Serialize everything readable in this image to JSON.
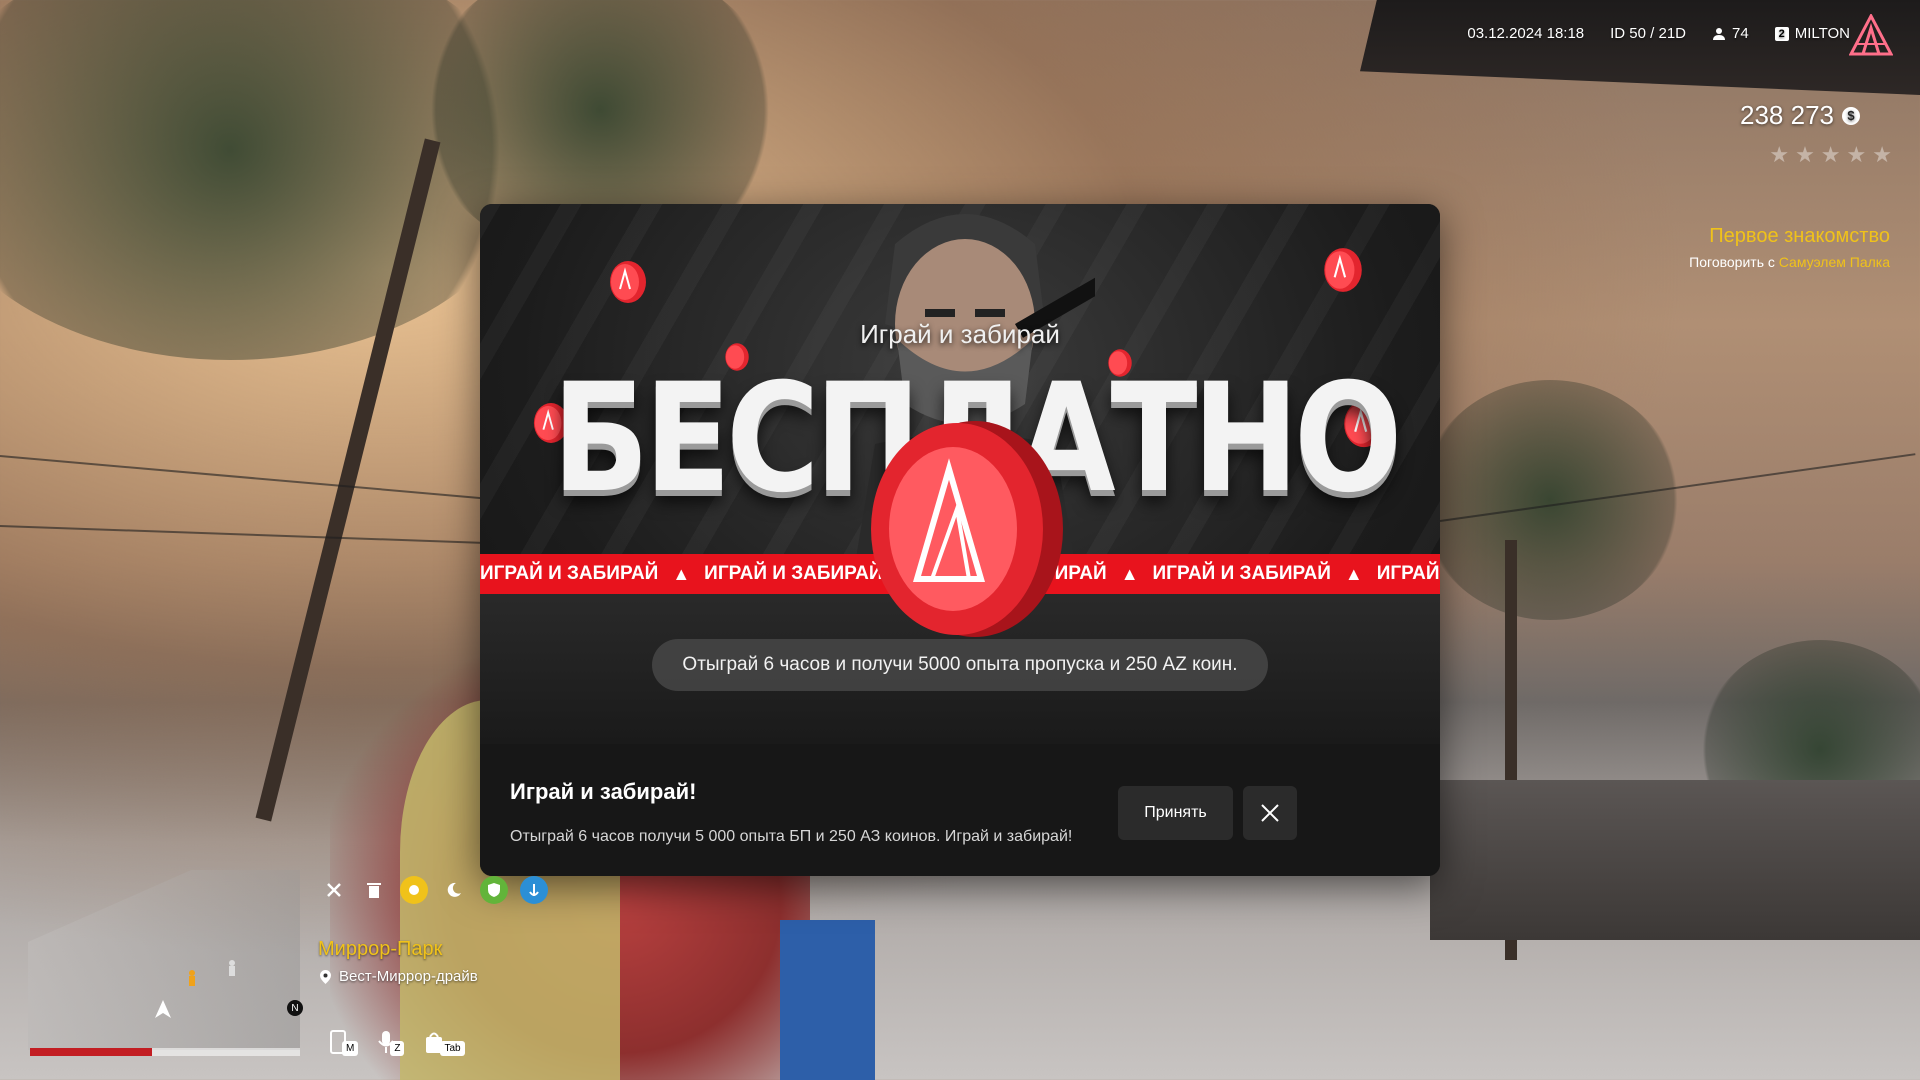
{
  "hud": {
    "datetime": "03.12.2024 18:18",
    "id": "ID 50 / 21D",
    "online": "74",
    "server_number": "2",
    "server_name": "MILTON",
    "money": "238 273",
    "money_icon": "$",
    "stars_total": 5,
    "stars_active": 0
  },
  "quest": {
    "title": "Первое знакомство",
    "prefix": "Поговорить с",
    "npc": "Самуэлем Палка"
  },
  "modal": {
    "banner_subtitle": "Играй и забирай",
    "banner_title": "БЕСПЛАТНО",
    "ribbon_text": "ИГРАЙ И ЗАБИРАЙ",
    "banner_caption": "Отыграй 6 часов и получи 5000 опыта пропуска и 250 AZ коин.",
    "title": "Играй и забирай!",
    "description": "Отыграй 6 часов получи 5 000 опыта БП и 250 АЗ коинов. Играй и забирай!",
    "accept_label": "Принять"
  },
  "location": {
    "area": "Миррор-Парк",
    "street": "Вест-Миррор-драйв"
  },
  "keys": [
    {
      "name": "phone",
      "key": "M"
    },
    {
      "name": "voice",
      "key": "Z"
    },
    {
      "name": "inventory",
      "key": "Tab"
    }
  ],
  "compass": "N",
  "colors": {
    "accent_yellow": "#f0c21a",
    "ribbon_red": "#e8131d",
    "modal_bg": "#171717"
  }
}
